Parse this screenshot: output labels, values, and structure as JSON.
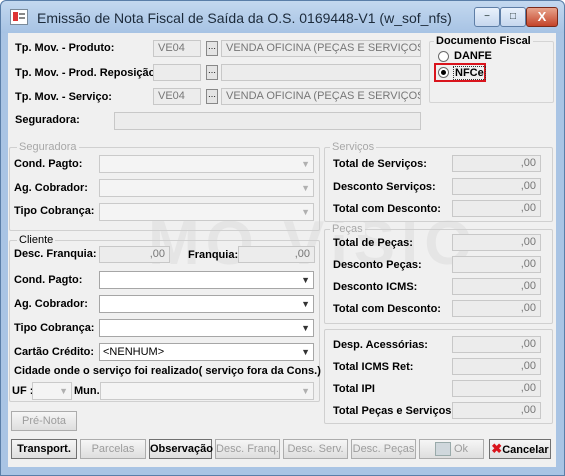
{
  "window": {
    "title": "Emissão de Nota Fiscal de Saída da O.S. 0169448-V1 (w_sof_nfs)",
    "minimize_glyph": "−",
    "maximize_glyph": "□",
    "close_glyph": "X"
  },
  "watermark": "MO VISIO",
  "header": {
    "rows": [
      {
        "label": "Tp. Mov. - Produto:",
        "code": "VE04",
        "description": "VENDA OFICINA (PEÇAS E SERVIÇOS)"
      },
      {
        "label": "Tp. Mov. - Prod. Reposição:",
        "code": "",
        "description": ""
      },
      {
        "label": "Tp. Mov. - Serviço:",
        "code": "VE04",
        "description": "VENDA OFICINA (PEÇAS E SERVIÇOS)"
      }
    ],
    "seguradora_label": "Seguradora:",
    "seguradora_value": "",
    "lookup_glyph": "⋯"
  },
  "documento_fiscal": {
    "title": "Documento Fiscal",
    "options": [
      {
        "label": "DANFE",
        "selected": false
      },
      {
        "label": "NFCe",
        "selected": true
      }
    ],
    "highlight_color": "#d9141c"
  },
  "seguradora_group": {
    "title": "Seguradora",
    "fields": [
      {
        "label": "Cond. Pagto:",
        "value": ""
      },
      {
        "label": "Ag. Cobrador:",
        "value": ""
      },
      {
        "label": "Tipo Cobrança:",
        "value": ""
      }
    ]
  },
  "cliente_group": {
    "title": "Cliente",
    "desc_franquia_label": "Desc. Franquia:",
    "desc_franquia_value": ",00",
    "franquia_label": "Franquia:",
    "franquia_value": ",00",
    "fields": [
      {
        "label": "Cond. Pagto:",
        "value": ""
      },
      {
        "label": "Ag. Cobrador:",
        "value": ""
      },
      {
        "label": "Tipo Cobrança:",
        "value": ""
      }
    ],
    "cartao_label": "Cartão Crédito:",
    "cartao_value": "<NENHUM>",
    "cidade_label": "Cidade onde o serviço foi realizado( serviço fora da Cons.)",
    "uf_label": "UF :",
    "uf_value": "",
    "mun_label": "Mun.:",
    "mun_value": ""
  },
  "servicos_group": {
    "title": "Serviços",
    "rows": [
      {
        "label": "Total de Serviços:",
        "value": ",00"
      },
      {
        "label": "Desconto Serviços:",
        "value": ",00"
      },
      {
        "label": "Total com Desconto:",
        "value": ",00"
      }
    ]
  },
  "pecas_group": {
    "title": "Peças",
    "rows": [
      {
        "label": "Total de Peças:",
        "value": ",00"
      },
      {
        "label": "Desconto Peças:",
        "value": ",00"
      },
      {
        "label": "Desconto ICMS:",
        "value": ",00"
      },
      {
        "label": "Total com Desconto:",
        "value": ",00"
      }
    ]
  },
  "totais_group": {
    "rows": [
      {
        "label": "Desp. Acessórias:",
        "value": ",00"
      },
      {
        "label": "Total ICMS Ret:",
        "value": ",00"
      },
      {
        "label": "Total IPI",
        "value": ",00"
      },
      {
        "label": "Total Peças e Serviços:",
        "value": ",00"
      }
    ]
  },
  "buttons": {
    "pre_nota": "Pré-Nota",
    "transport": "Transport.",
    "parcelas": "Parcelas",
    "observacao": "Observação",
    "desc_franq": "Desc. Franq.",
    "desc_serv": "Desc. Serv.",
    "desc_pecas": "Desc. Peças",
    "ok": "Ok",
    "cancelar": "Cancelar"
  }
}
